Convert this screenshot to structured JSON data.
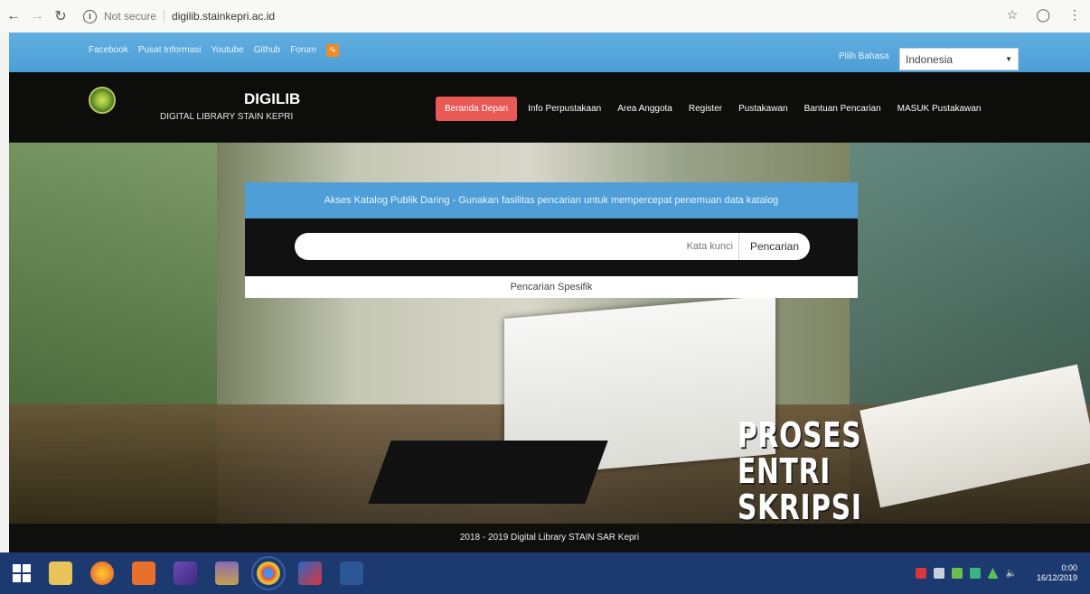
{
  "browser": {
    "not_secure": "Not secure",
    "url": "digilib.stainkepri.ac.id"
  },
  "topbar": {
    "links": [
      "Facebook",
      "Pusat Informasi",
      "Youtube",
      "Github",
      "Forum"
    ],
    "language_label": "Pilih Bahasa",
    "language_selected": "Indonesia"
  },
  "header": {
    "title": "DIGILIB",
    "subtitle": "DIGITAL LIBRARY STAIN KEPRI",
    "menu": [
      "Beranda Depan",
      "Info Perpustakaan",
      "Area Anggota",
      "Register",
      "Pustakawan",
      "Bantuan Pencarian",
      "MASUK Pustakawan"
    ]
  },
  "search": {
    "heading": "Akses Katalog Publik Daring - Gunakan fasilitas pencarian untuk mempercepat penemuan data katalog",
    "placeholder": "Kata kunci",
    "button": "Pencarian",
    "specific": "Pencarian Spesifik"
  },
  "hero": {
    "overlay_lines": [
      "PROSES",
      "ENTRI",
      "SKRIPSI"
    ]
  },
  "footer": {
    "text": "2018 - 2019 Digital Library STAIN SAR Kepri"
  },
  "taskbar": {
    "time": "0:00",
    "date": "16/12/2019"
  },
  "colors": {
    "topbar": "#4c9fd6",
    "active_menu": "#e95a57",
    "header_bg": "#0d0d0c",
    "taskbar": "#1d3a70"
  }
}
